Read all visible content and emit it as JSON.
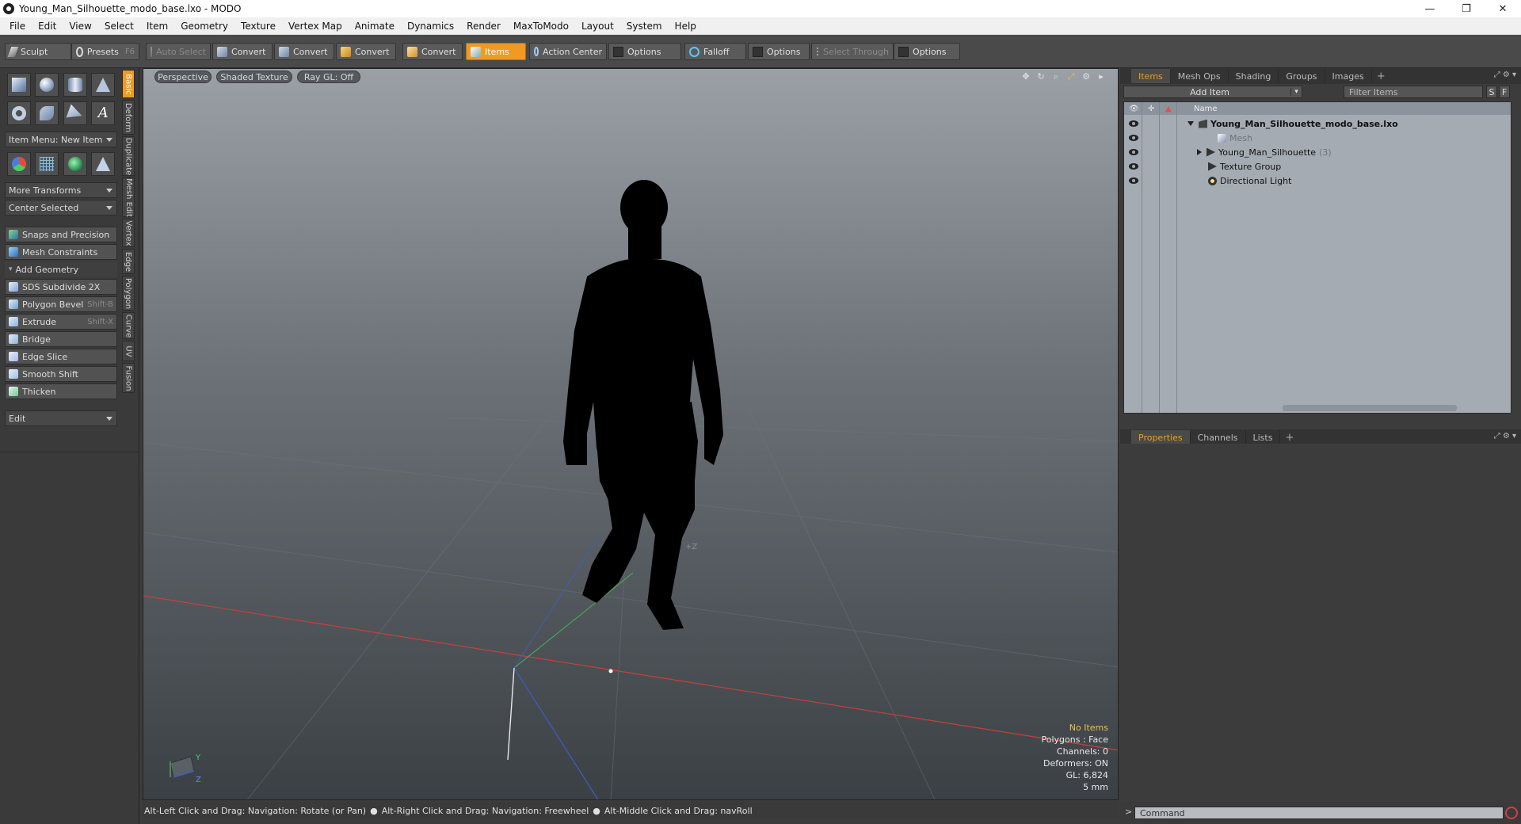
{
  "window": {
    "title": "Young_Man_Silhouette_modo_base.lxo - MODO",
    "minimize": "—",
    "maximize": "❐",
    "close": "✕"
  },
  "menu": [
    "File",
    "Edit",
    "View",
    "Select",
    "Item",
    "Geometry",
    "Texture",
    "Vertex Map",
    "Animate",
    "Dynamics",
    "Render",
    "MaxToModo",
    "Layout",
    "System",
    "Help"
  ],
  "toolbar": {
    "sculpt": "Sculpt",
    "presets": "Presets",
    "presets_shortcut": "F6",
    "auto_select": "Auto Select",
    "convert": "Convert",
    "items": "Items",
    "action_center": "Action Center",
    "options": "Options",
    "falloff": "Falloff",
    "select_through": "Select Through"
  },
  "left_panel": {
    "item_menu": "Item Menu: New Item",
    "more_transforms": "More Transforms",
    "center_selected": "Center Selected",
    "snaps": "Snaps and Precision",
    "mesh_constraints": "Mesh Constraints",
    "add_geometry": "Add Geometry",
    "tools": [
      {
        "label": "SDS Subdivide 2X",
        "shortcut": ""
      },
      {
        "label": "Polygon Bevel",
        "shortcut": "Shift-B"
      },
      {
        "label": "Extrude",
        "shortcut": "Shift-X"
      },
      {
        "label": "Bridge",
        "shortcut": ""
      },
      {
        "label": "Edge Slice",
        "shortcut": ""
      },
      {
        "label": "Smooth Shift",
        "shortcut": ""
      },
      {
        "label": "Thicken",
        "shortcut": ""
      }
    ],
    "edit": "Edit"
  },
  "vertical_tabs": [
    "Basic",
    "Deform",
    "Duplicate",
    "Mesh Edit",
    "Vertex",
    "Edge",
    "Polygon",
    "Curve",
    "UV",
    "Fusion"
  ],
  "viewport": {
    "view": "Perspective",
    "shading": "Shaded Texture",
    "raygl": "Ray GL: Off",
    "axis_label_z": "+Z",
    "gizmo_y": "Y",
    "gizmo_z": "Z",
    "info": {
      "no_items": "No Items",
      "polygons": "Polygons : Face",
      "channels": "Channels: 0",
      "deformers": "Deformers: ON",
      "gl": "GL: 6,824",
      "scale": "5 mm"
    }
  },
  "status_bar": {
    "hint1": "Alt-Left Click and Drag: Navigation: Rotate (or Pan)",
    "hint2": "Alt-Right Click and Drag: Navigation: Freewheel",
    "hint3": "Alt-Middle Click and Drag: navRoll"
  },
  "items_panel": {
    "tabs": [
      "Items",
      "Mesh Ops",
      "Shading",
      "Groups",
      "Images"
    ],
    "add_item": "Add Item",
    "filter_placeholder": "Filter Items",
    "btn_s": "S",
    "btn_f": "F",
    "name_header": "Name",
    "tree": [
      {
        "label": "Young_Man_Silhouette_modo_base.lxo",
        "count": "",
        "type": "scene"
      },
      {
        "label": "Mesh",
        "count": "",
        "type": "mesh"
      },
      {
        "label": "Young_Man_Silhouette",
        "count": "(3)",
        "type": "group"
      },
      {
        "label": "Texture Group",
        "count": "",
        "type": "group"
      },
      {
        "label": "Directional Light",
        "count": "",
        "type": "light"
      }
    ]
  },
  "props_panel": {
    "tabs": [
      "Properties",
      "Channels",
      "Lists"
    ]
  },
  "command": {
    "prompt": ">",
    "placeholder": "Command"
  },
  "colors": {
    "accent": "#f09a24",
    "viewport_top": "#9aa0a6",
    "viewport_bottom": "#3b4045"
  }
}
